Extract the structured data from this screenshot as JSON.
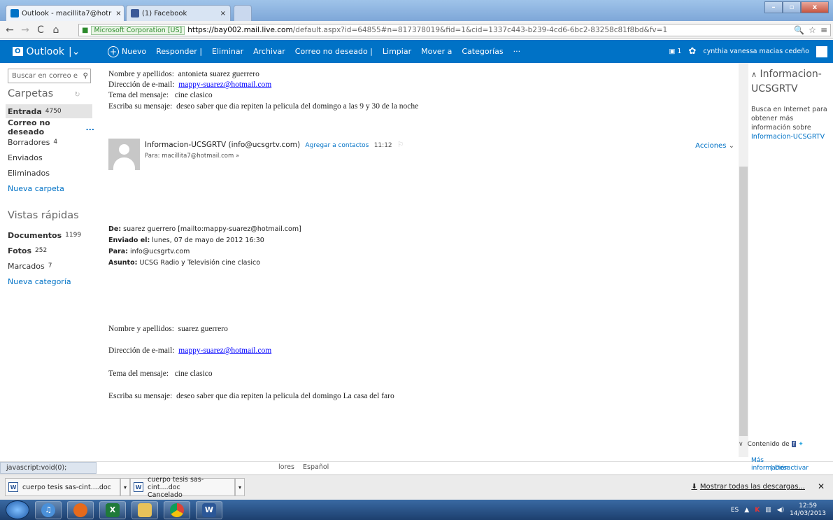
{
  "browser": {
    "tabs": [
      {
        "label": "Outlook - macillita7@hotr",
        "close": "×"
      },
      {
        "label": "(1) Facebook",
        "close": "×"
      }
    ],
    "window_controls": {
      "minimize": "–",
      "maximize": "▫",
      "close": "x"
    },
    "cert_label": "Microsoft Corporation [US]",
    "url_domain": "https://bay002.mail.live.com",
    "url_rest": "/default.aspx?id=64855#n=817378019&fid=1&cid=1337c443-b239-4cd6-6bc2-83258c81f8bd&fv=1",
    "colors": {
      "outlook_blue": "#0072c6",
      "tab_bar": "#8fb4e3"
    }
  },
  "outlook": {
    "app_name": "Outlook",
    "commands": [
      "Nuevo",
      "Responder |",
      "Eliminar",
      "Archivar",
      "Correo no deseado |",
      "Limpiar",
      "Mover a",
      "Categorías",
      "···"
    ],
    "chat_count": "1",
    "user_name": "cynthia vanessa macias cedeño"
  },
  "sidebar": {
    "search_placeholder": "Buscar en correo e",
    "folders_title": "Carpetas",
    "folders": [
      {
        "label": "Entrada",
        "count": "4750"
      },
      {
        "label": "Correo no deseado",
        "count": "..."
      },
      {
        "label": "Borradores",
        "count": "4"
      },
      {
        "label": "Enviados",
        "count": ""
      },
      {
        "label": "Eliminados",
        "count": ""
      },
      {
        "label": "Nueva carpeta",
        "count": ""
      }
    ],
    "quick_title": "Vistas rápidas",
    "quick": [
      {
        "label": "Documentos",
        "count": "1199"
      },
      {
        "label": "Fotos",
        "count": "252"
      },
      {
        "label": "Marcados",
        "count": "7"
      },
      {
        "label": "Nueva categoría",
        "count": ""
      }
    ]
  },
  "message": {
    "top": {
      "name_label": "Nombre y apellidos:",
      "name_value": "antonieta suarez guerrero",
      "email_label": "Dirección de e-mail:",
      "email_value": "mappy-suarez@hotmail.com",
      "subject_label": "Tema del mensaje:",
      "subject_value": "cine clasico",
      "msg_label": "Escriba su mensaje:",
      "msg_value": "deseo saber que dia repiten la pelicula del domingo a las 9 y 30 de la noche"
    },
    "header": {
      "sender": "Informacion-UCSGRTV (info@ucsgrtv.com)",
      "add_contacts": "Agregar a contactos",
      "time": "11:12",
      "to": "Para: macillita7@hotmail.com",
      "actions": "Acciones"
    },
    "quoted": {
      "de_label": "De:",
      "de_value": "suarez guerrero [mailto:mappy-suarez@hotmail.com]",
      "enviado_label": "Enviado el:",
      "enviado_value": "lunes, 07 de mayo de 2012 16:30",
      "para_label": "Para:",
      "para_value": "info@ucsgrtv.com",
      "asunto_label": "Asunto:",
      "asunto_value": "UCSG Radio y Televisión cine clasico"
    },
    "bottom": {
      "name_label": "Nombre y apellidos:",
      "name_value": "suarez guerrero",
      "email_label": "Dirección de e-mail:",
      "email_value": "mappy-suarez@hotmail.com",
      "subject_label": "Tema del mensaje:",
      "subject_value": "cine clasico",
      "msg_label": "Escriba su mensaje:",
      "msg_value": "deseo saber que dia repiten la pelicula del domingo La casa del faro"
    }
  },
  "right_pane": {
    "title": "Informacion-UCSGRTV",
    "desc": "Busca en Internet para obtener más información sobre",
    "desc_link": "Informacion-UCSGRTV",
    "content_label": "Contenido de",
    "more_info": "Más información",
    "deactivate": "Desactivar"
  },
  "status": {
    "text": "javascript:void(0);",
    "footer_colors": "lores",
    "footer_lang": "Español"
  },
  "downloads": {
    "items": [
      {
        "name": "cuerpo tesis sas-cint....doc",
        "sub": ""
      },
      {
        "name": "cuerpo tesis sas-cint....doc",
        "sub": "Cancelado"
      }
    ],
    "show_all": "Mostrar todas las descargas...",
    "close": "✕"
  },
  "taskbar": {
    "lang": "ES",
    "time": "12:59",
    "date": "14/03/2013"
  }
}
